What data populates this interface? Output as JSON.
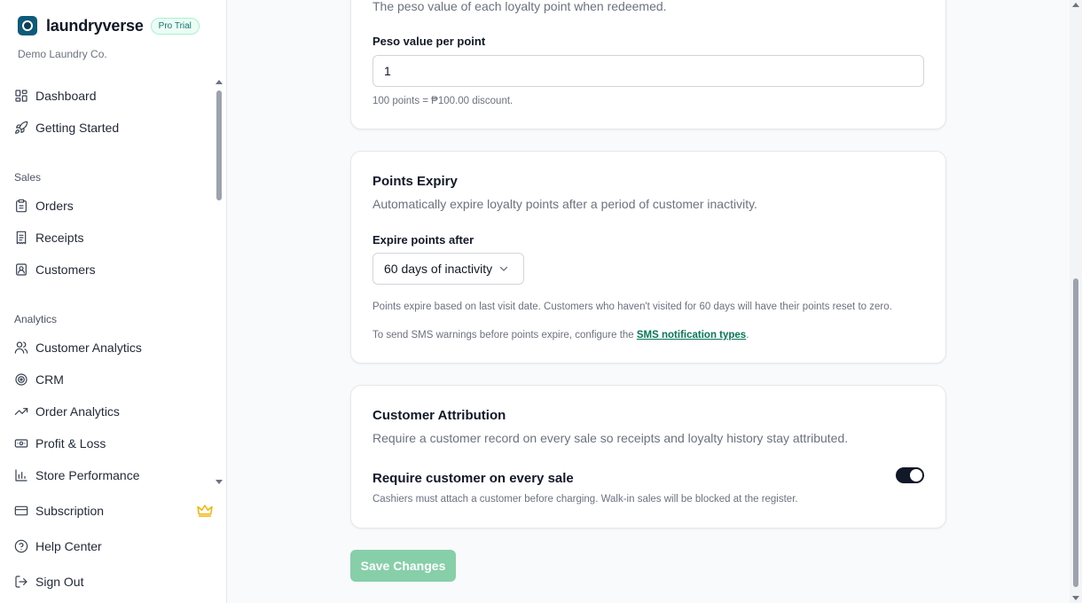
{
  "brand": {
    "name": "laundryverse",
    "badge": "Pro Trial",
    "org": "Demo Laundry Co."
  },
  "sidebar": {
    "top_items": [
      {
        "label": "Dashboard",
        "icon": "layout-grid-icon"
      },
      {
        "label": "Getting Started",
        "icon": "rocket-icon"
      }
    ],
    "sales_label": "Sales",
    "sales_items": [
      {
        "label": "Orders",
        "icon": "clipboard-icon"
      },
      {
        "label": "Receipts",
        "icon": "receipt-icon"
      },
      {
        "label": "Customers",
        "icon": "contact-icon"
      }
    ],
    "analytics_label": "Analytics",
    "analytics_items": [
      {
        "label": "Customer Analytics",
        "icon": "users-icon"
      },
      {
        "label": "CRM",
        "icon": "target-icon"
      },
      {
        "label": "Order Analytics",
        "icon": "trending-up-icon"
      },
      {
        "label": "Profit & Loss",
        "icon": "banknote-icon"
      },
      {
        "label": "Store Performance",
        "icon": "bar-chart-icon"
      }
    ],
    "bottom_items": [
      {
        "label": "Subscription",
        "icon": "credit-card-icon"
      },
      {
        "label": "Help Center",
        "icon": "help-circle-icon"
      },
      {
        "label": "Sign Out",
        "icon": "log-out-icon"
      }
    ]
  },
  "redemption": {
    "desc": "The peso value of each loyalty point when redeemed.",
    "field_label": "Peso value per point",
    "value": "1",
    "hint": "100 points = ₱100.00 discount."
  },
  "expiry": {
    "title": "Points Expiry",
    "desc": "Automatically expire loyalty points after a period of customer inactivity.",
    "field_label": "Expire points after",
    "selected": "60 days of inactivity",
    "hint": "Points expire based on last visit date. Customers who haven't visited for 60 days will have their points reset to zero.",
    "sms_prefix": "To send SMS warnings before points expire, configure the ",
    "sms_link": "SMS notification types",
    "sms_suffix": "."
  },
  "attribution": {
    "title": "Customer Attribution",
    "desc": "Require a customer record on every sale so receipts and loyalty history stay attributed.",
    "toggle_label": "Require customer on every sale",
    "toggle_hint": "Cashiers must attach a customer before charging. Walk-in sales will be blocked at the register.",
    "toggle_on": true
  },
  "save_label": "Save Changes",
  "colors": {
    "accent": "#047857",
    "save_button": "#86cfa9",
    "toggle_on": "#111827",
    "crown": "#f5b301"
  }
}
